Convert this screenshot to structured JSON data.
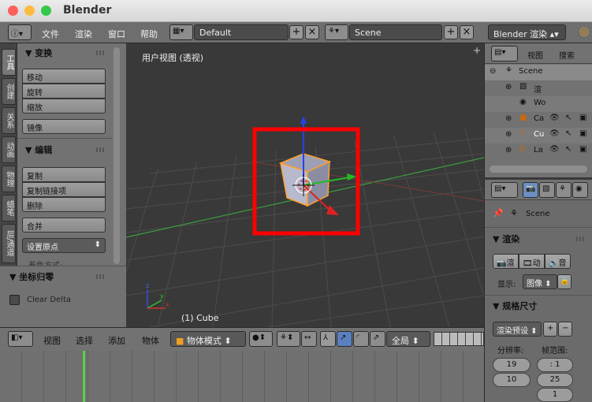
{
  "window": {
    "title": "Blender"
  },
  "menu": {
    "file": "文件",
    "render": "渲染",
    "window": "窗口",
    "help": "帮助",
    "layout_value": "Default",
    "scene_value": "Scene",
    "engine_value": "Blender 渲染"
  },
  "tabs": [
    "工具",
    "创建",
    "关系",
    "动画",
    "物理",
    "蜡笔",
    "层/通道"
  ],
  "tools": {
    "transform_header": "▼ 变换",
    "move": "移动",
    "rotate": "旋转",
    "scale": "缩放",
    "mirror": "镜像",
    "edit_header": "▼ 编辑",
    "duplicate": "复制",
    "duplicate_linked": "复制链接项",
    "delete": "删除",
    "join": "合并",
    "set_origin": "设置原点",
    "shading_partial": "着色方式:",
    "reset_header": "▼ 坐标归零",
    "clear_delta": "Clear Delta"
  },
  "viewport": {
    "title": "用户视图 (透视)",
    "object_label": "(1) Cube",
    "axis_z": "z",
    "axis_y": "y",
    "axis_x": "x"
  },
  "header3d": {
    "view": "视图",
    "select": "选择",
    "add": "添加",
    "object": "物体",
    "mode": "物体模式",
    "global": "全局"
  },
  "outliner": {
    "view": "视图",
    "search": "搜索",
    "items": [
      "Scene",
      "渲",
      "Wo",
      "Ca",
      "Cu",
      "La"
    ]
  },
  "properties": {
    "scene_label": "Scene",
    "render_header": "▼ 渲染",
    "render_btn": "渲",
    "anim_btn": "动",
    "audio_btn": "音",
    "display_label": "显示:",
    "display_value": "图像",
    "dims_header": "▼ 规格尺寸",
    "preset": "渲染预设",
    "resolution_label": "分辨率:",
    "frame_range_label": "帧范围:",
    "res_x": "19",
    "res_y": "10",
    "frame_start": ": 1",
    "frame_end": "25",
    "frame_step": "1"
  },
  "colors": {
    "highlight_box": "#ff0000",
    "cube_outline": "#ffa030",
    "axis_x": "#d03030",
    "axis_y": "#30c030",
    "axis_z": "#3050e0"
  }
}
